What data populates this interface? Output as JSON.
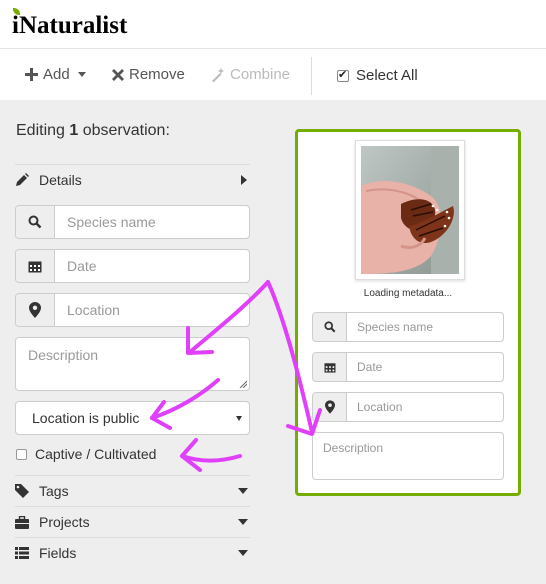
{
  "app": {
    "logo_text": "Naturalist",
    "logo_initial": "i"
  },
  "toolbar": {
    "add_label": "Add",
    "remove_label": "Remove",
    "combine_label": "Combine",
    "select_all_label": "Select All",
    "select_all_checked": true
  },
  "editor": {
    "title_prefix": "Editing",
    "count": "1",
    "title_suffix": "observation:",
    "details_label": "Details",
    "species_placeholder": "Species name",
    "date_placeholder": "Date",
    "location_placeholder": "Location",
    "description_placeholder": "Description",
    "location_privacy_selected": "Location is public",
    "captive_label": "Captive / Cultivated",
    "captive_checked": false,
    "tags_label": "Tags",
    "projects_label": "Projects",
    "fields_label": "Fields"
  },
  "card": {
    "photo_subject": "butterfly-on-hand",
    "status_text": "Loading metadata...",
    "species_placeholder": "Species name",
    "date_placeholder": "Date",
    "location_placeholder": "Location",
    "description_placeholder": "Description"
  },
  "colors": {
    "brand_green": "#74ac00",
    "annotation_arrow": "#e040fb",
    "panel_bg": "#eeeeee"
  },
  "icons": {
    "add": "plus-icon",
    "remove": "x-icon",
    "combine": "wand-icon",
    "details": "pencil-icon",
    "species": "search-icon",
    "date": "calendar-icon",
    "location": "map-marker-icon",
    "tags": "tag-icon",
    "projects": "briefcase-icon",
    "fields": "list-icon"
  }
}
